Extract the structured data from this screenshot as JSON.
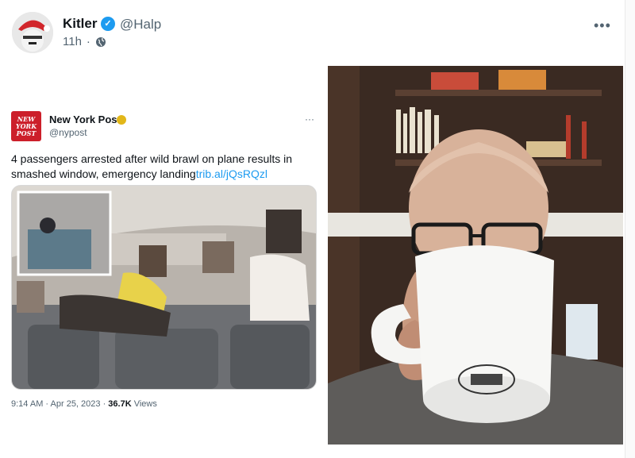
{
  "post": {
    "author_name": "Kitler",
    "author_handle": "@Halp",
    "time": "11h",
    "separator": "·",
    "more_label": "•••"
  },
  "embed": {
    "account_name": "New York Post",
    "account_handle": "@nypost",
    "logo_line1": "NEW",
    "logo_line2": "YORK",
    "logo_line3": "POST",
    "text": "4 passengers arrested after wild brawl on plane results in smashed window, emergency landing",
    "link": "trib.al/jQsRQzl",
    "timestamp": "9:14 AM · Apr 25, 2023 · ",
    "views_count": "36.7K",
    "views_label": " Views",
    "more_label": "···"
  },
  "colors": {
    "accent": "#1d9bf0",
    "nypost_red": "#cc1f2a",
    "secondary_text": "#536471"
  }
}
